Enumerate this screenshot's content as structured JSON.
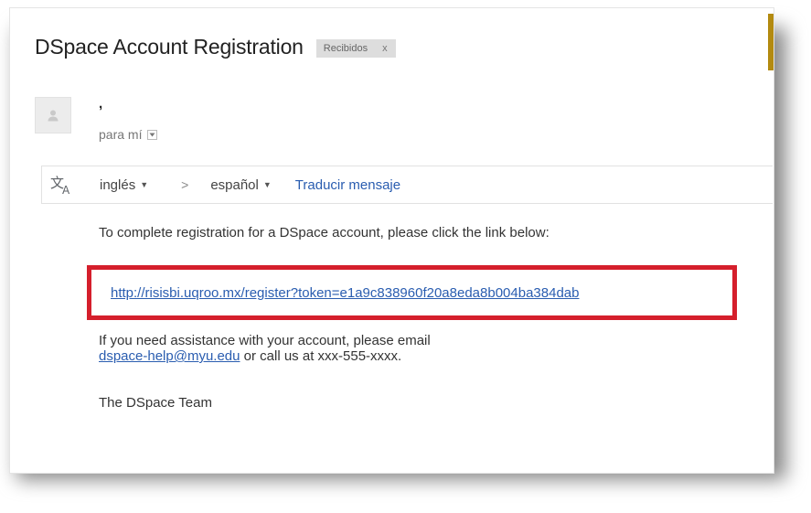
{
  "email": {
    "subject": "DSpace Account Registration",
    "label_chip": {
      "text": "Recibidos",
      "close": "x"
    },
    "sender": {
      "name": ",",
      "to_label": "para mí"
    },
    "translate_bar": {
      "icon": "translate-icon",
      "source_language": "inglés",
      "target_language": "español",
      "separator": ">",
      "action_label": "Traducir mensaje"
    },
    "body": {
      "intro": "To complete registration for a DSpace account, please click the link below:",
      "registration_link": "http://risisbi.uqroo.mx/register?token=e1a9c838960f20a8eda8b004ba384dab",
      "assistance_text": "If you need assistance with your account, please email",
      "help_email": "dspace-help@myu.edu",
      "call_text": "or call us at xxx-555-xxxx.",
      "signoff": "The DSpace Team"
    }
  },
  "colors": {
    "link": "#2a5db0",
    "highlight_box": "#d51f2c",
    "accent_bar": "#b38a10"
  }
}
